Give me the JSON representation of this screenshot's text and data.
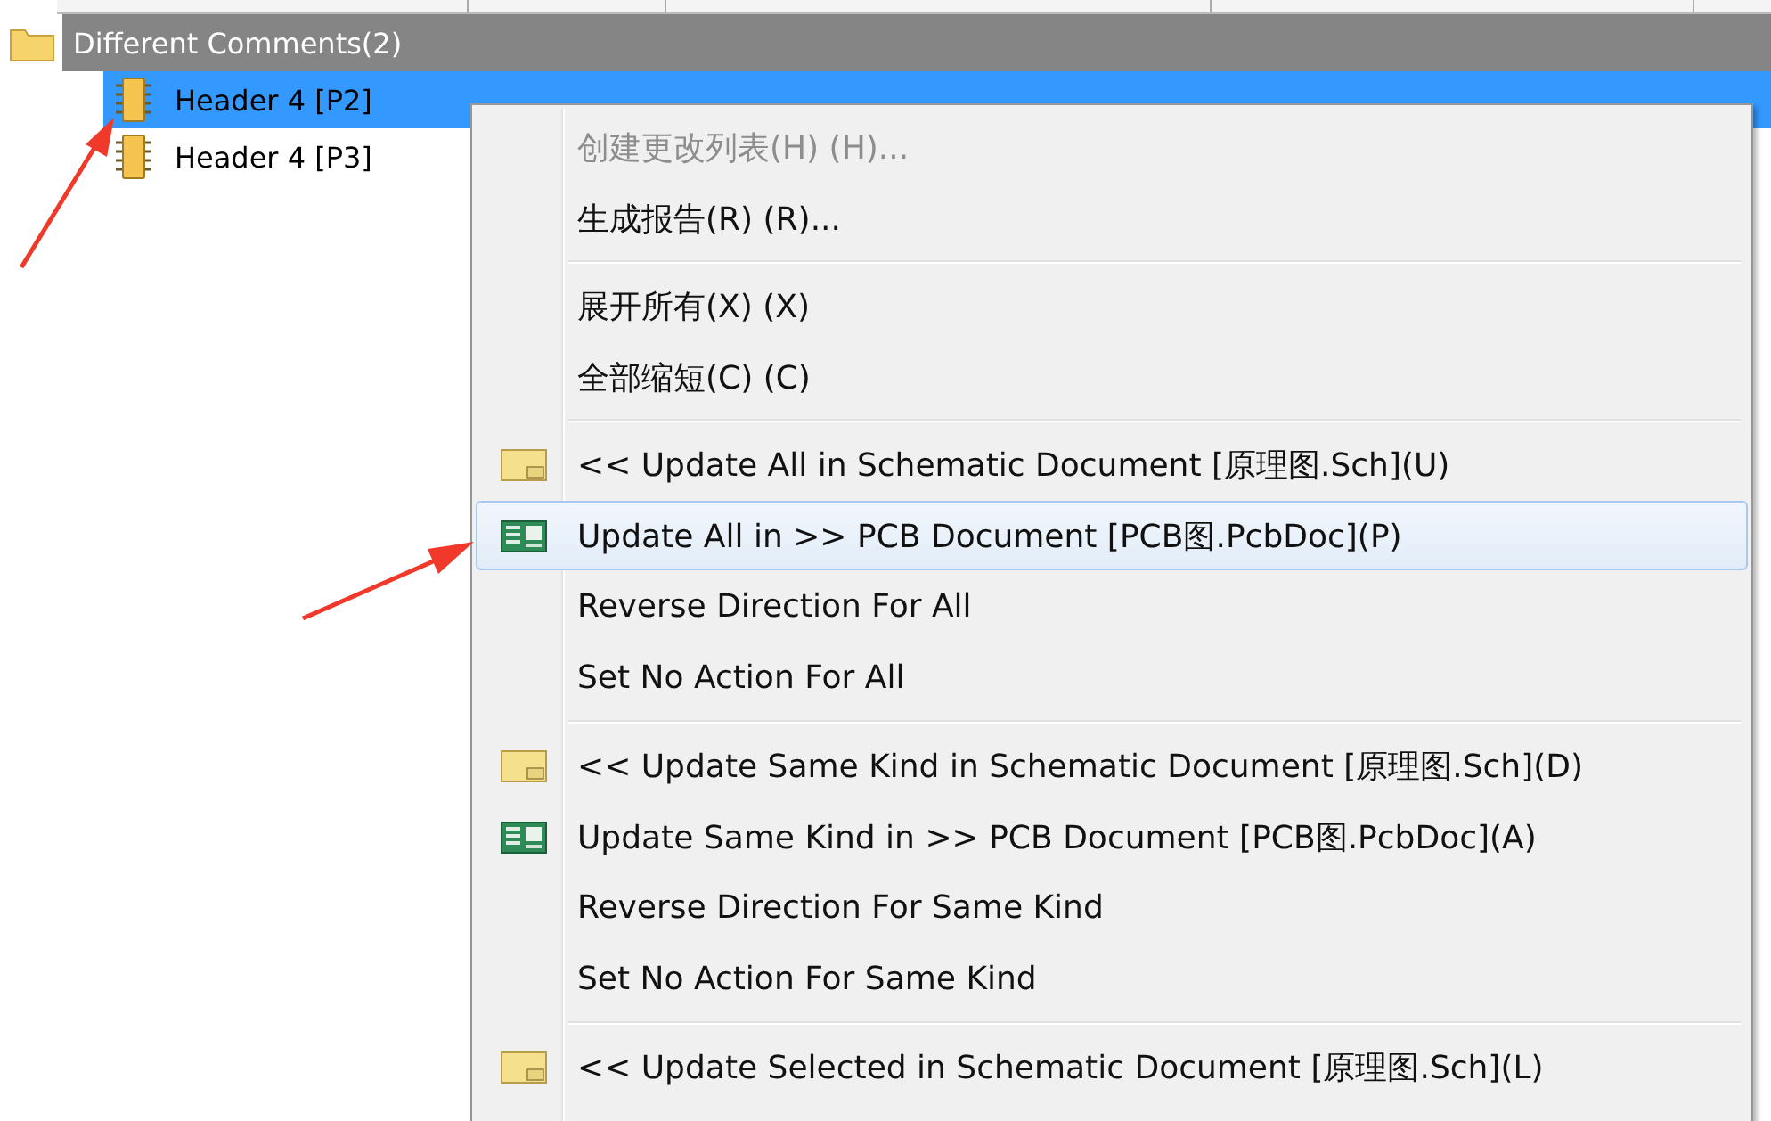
{
  "group": {
    "label": "Different Comments(2)"
  },
  "rows": [
    {
      "name": "Header 4 [P2]",
      "selected": true
    },
    {
      "name": "Header 4 [P3]",
      "selected": false
    }
  ],
  "context_menu": {
    "groups": [
      [
        {
          "label": "创建更改列表(H) (H)...",
          "kind": "plain",
          "disabled": true,
          "selected": false
        },
        {
          "label": "生成报告(R) (R)...",
          "kind": "plain",
          "disabled": false,
          "selected": false
        }
      ],
      [
        {
          "label": "展开所有(X) (X)",
          "kind": "plain",
          "disabled": false,
          "selected": false
        },
        {
          "label": "全部缩短(C) (C)",
          "kind": "plain",
          "disabled": false,
          "selected": false
        }
      ],
      [
        {
          "label": "<< Update All in Schematic Document [原理图.Sch](U)",
          "kind": "schematic",
          "disabled": false,
          "selected": false
        },
        {
          "label": "Update All in >> PCB Document [PCB图.PcbDoc](P)",
          "kind": "pcb",
          "disabled": false,
          "selected": true
        },
        {
          "label": "Reverse Direction For All",
          "kind": "plain",
          "disabled": false,
          "selected": false
        },
        {
          "label": "Set No Action For All",
          "kind": "plain",
          "disabled": false,
          "selected": false
        }
      ],
      [
        {
          "label": "<< Update Same Kind in Schematic Document [原理图.Sch](D)",
          "kind": "schematic",
          "disabled": false,
          "selected": false
        },
        {
          "label": "Update Same Kind in >> PCB Document [PCB图.PcbDoc](A)",
          "kind": "pcb",
          "disabled": false,
          "selected": false
        },
        {
          "label": "Reverse Direction For Same Kind",
          "kind": "plain",
          "disabled": false,
          "selected": false
        },
        {
          "label": "Set No Action For Same Kind",
          "kind": "plain",
          "disabled": false,
          "selected": false
        }
      ],
      [
        {
          "label": "<< Update Selected in Schematic Document [原理图.Sch](L)",
          "kind": "schematic",
          "disabled": false,
          "selected": false
        }
      ]
    ]
  }
}
